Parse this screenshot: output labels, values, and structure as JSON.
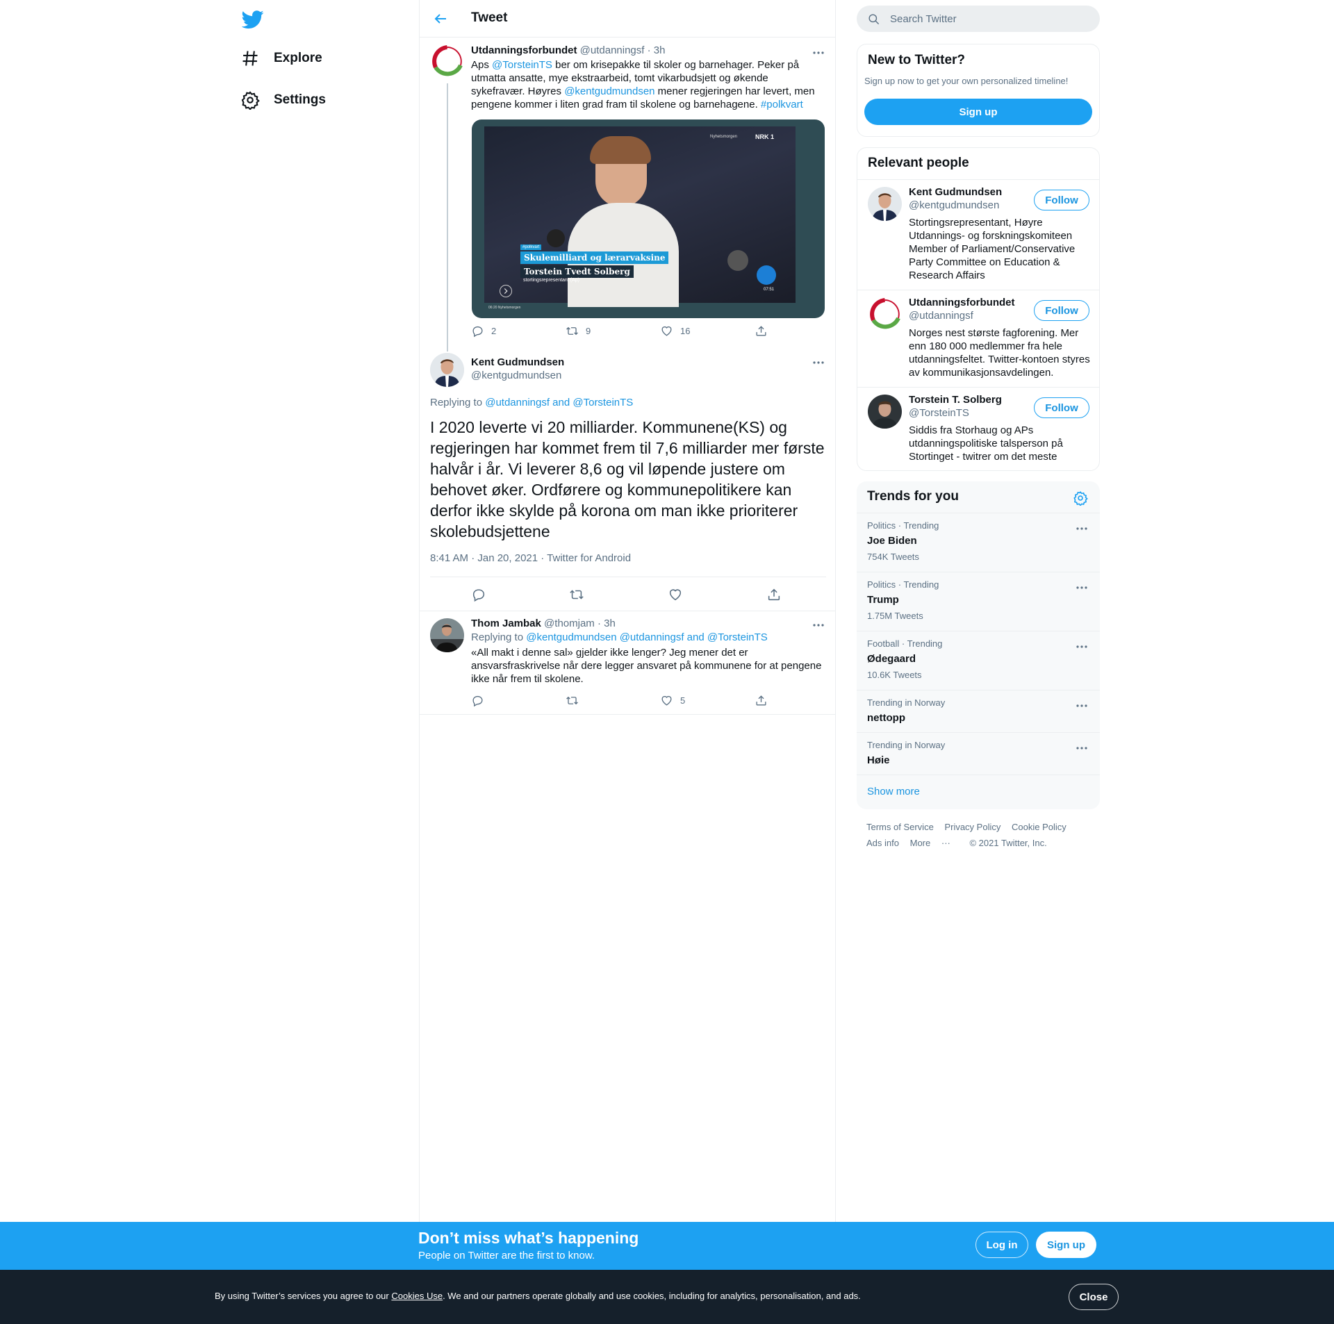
{
  "nav": {
    "items": [
      {
        "label": "Explore",
        "icon": "hashtag-icon"
      },
      {
        "label": "Settings",
        "icon": "gear-icon"
      }
    ]
  },
  "header": {
    "title": "Tweet"
  },
  "parent_tweet": {
    "name": "Utdanningsforbundet",
    "handle": "@utdanningsf",
    "time": "· 3h",
    "text_parts": [
      "Aps ",
      "@TorsteinTS",
      " ber om krisepakke til skoler og barnehager. Peker på utmatta ansatte, mye ekstraarbeid, tomt vikarbudsjett og økende sykefravær. Høyres ",
      "@kentgudmundsen",
      " mener regjeringen har levert, men pengene kommer i liten grad fram til skolene og barnehagene. ",
      "#polkvart"
    ],
    "media": {
      "tag": "#polkvart",
      "headline": "Skulemilliard og lærarvaksine",
      "person": "Torstein Tvedt Solberg",
      "role": "stortingsrepresentant (Ap)",
      "program": "Nyhetsmorgen",
      "channel": "NRK 1",
      "time": "07:51",
      "corner_label": "06:20 Nyhetsmorgen"
    },
    "replies": "2",
    "retweets": "9",
    "likes": "16"
  },
  "main_tweet": {
    "name": "Kent Gudmundsen",
    "handle": "@kentgudmundsen",
    "replying_label": "Replying to ",
    "replying_to": "@utdanningsf and @TorsteinTS",
    "text": "I 2020 leverte vi 20 milliarder. Kommunene(KS) og regjeringen har kommet frem til 7,6 milliarder mer første halvår i år. Vi leverer 8,6 og vil løpende justere om behovet øker. Ordførere og kommunepolitikere kan derfor ikke skylde på korona om man ikke prioriterer skolebudsjettene",
    "timestamp": "8:41 AM · Jan 20, 2021",
    "source": "Twitter for Android"
  },
  "reply_tweet": {
    "name": "Thom Jambak",
    "handle": "@thomjam",
    "time": "· 3h",
    "replying_label": "Replying to ",
    "replying_to": "@kentgudmundsen @utdanningsf and @TorsteinTS",
    "text": "«All makt i denne sal» gjelder ikke lenger? Jeg mener det er ansvarsfraskrivelse når dere legger ansvaret på kommunene for at pengene ikke når frem til skolene.",
    "likes": "5"
  },
  "search": {
    "placeholder": "Search Twitter"
  },
  "new_to_twitter": {
    "title": "New to Twitter?",
    "subtitle": "Sign up now to get your own personalized timeline!",
    "button": "Sign up"
  },
  "relevant_people": {
    "title": "Relevant people",
    "people": [
      {
        "name": "Kent Gudmundsen",
        "handle": "@kentgudmundsen",
        "follow": "Follow",
        "bio": "Stortingsrepresentant, Høyre Utdannings- og forskningskomiteen Member of Parliament/Conservative Party Committee on Education & Research Affairs"
      },
      {
        "name": "Utdanningsforbundet",
        "handle": "@utdanningsf",
        "follow": "Follow",
        "bio": "Norges nest største fagforening. Mer enn 180 000 medlemmer fra hele utdanningsfeltet. Twitter-kontoen styres av kommunikasjonsavdelingen."
      },
      {
        "name": "Torstein T. Solberg",
        "handle": "@TorsteinTS",
        "follow": "Follow",
        "bio": "Siddis fra Storhaug og APs utdanningspolitiske talsperson på Stortinget - twitrer om det meste"
      }
    ]
  },
  "trends": {
    "title": "Trends for you",
    "items": [
      {
        "meta": "Politics · Trending",
        "name": "Joe Biden",
        "count": "754K Tweets"
      },
      {
        "meta": "Politics · Trending",
        "name": "Trump",
        "count": "1.75M Tweets"
      },
      {
        "meta": "Football · Trending",
        "name": "Ødegaard",
        "count": "10.6K Tweets"
      },
      {
        "meta": "Trending in Norway",
        "name": "nettopp",
        "count": ""
      },
      {
        "meta": "Trending in Norway",
        "name": "Høie",
        "count": ""
      }
    ],
    "show_more": "Show more"
  },
  "footer": {
    "links": [
      "Terms of Service",
      "Privacy Policy",
      "Cookie Policy",
      "Ads info",
      "More"
    ],
    "copyright": "© 2021 Twitter, Inc."
  },
  "bottom_bar": {
    "title": "Don’t miss what’s happening",
    "subtitle": "People on Twitter are the first to know.",
    "login": "Log in",
    "signup": "Sign up"
  },
  "cookie_bar": {
    "text_before": "By using Twitter’s services you agree to our ",
    "link": "Cookies Use",
    "text_after": ". We and our partners operate globally and use cookies, including for analytics, personalisation, and ads.",
    "close": "Close"
  },
  "colors": {
    "accent": "#1da1f2",
    "link": "#1b95e0",
    "text_secondary": "#5b7083",
    "cookie_bg": "#15202b"
  }
}
